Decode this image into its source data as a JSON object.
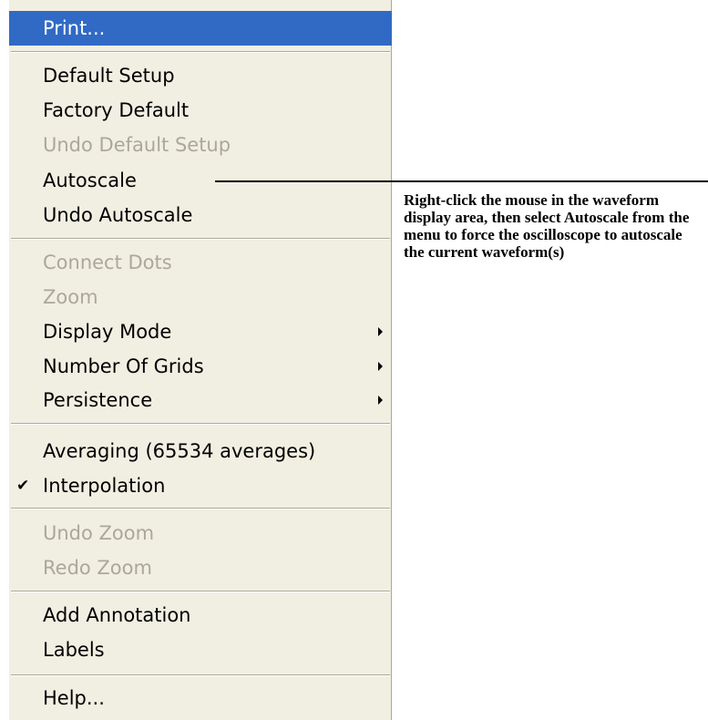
{
  "menu": {
    "items": [
      {
        "label": "Print..."
      },
      {
        "label": "Default Setup"
      },
      {
        "label": "Factory Default"
      },
      {
        "label": "Undo Default Setup"
      },
      {
        "label": "Autoscale"
      },
      {
        "label": "Undo Autoscale"
      },
      {
        "label": "Connect Dots"
      },
      {
        "label": "Zoom"
      },
      {
        "label": "Display Mode"
      },
      {
        "label": "Number Of Grids"
      },
      {
        "label": "Persistence"
      },
      {
        "label": "Averaging (65534 averages)"
      },
      {
        "label": "Interpolation",
        "check": "✔"
      },
      {
        "label": "Undo Zoom"
      },
      {
        "label": "Redo Zoom"
      },
      {
        "label": "Add Annotation"
      },
      {
        "label": "Labels"
      },
      {
        "label": "Help..."
      }
    ]
  },
  "callout": {
    "text": "Right-click the mouse in the waveform display area, then select Autoscale from the menu to force the oscilloscope to autoscale the current waveform(s)"
  },
  "colors": {
    "highlight": "#316ac5",
    "menu_background": "#f1efe2",
    "disabled_text": "#aca899"
  }
}
